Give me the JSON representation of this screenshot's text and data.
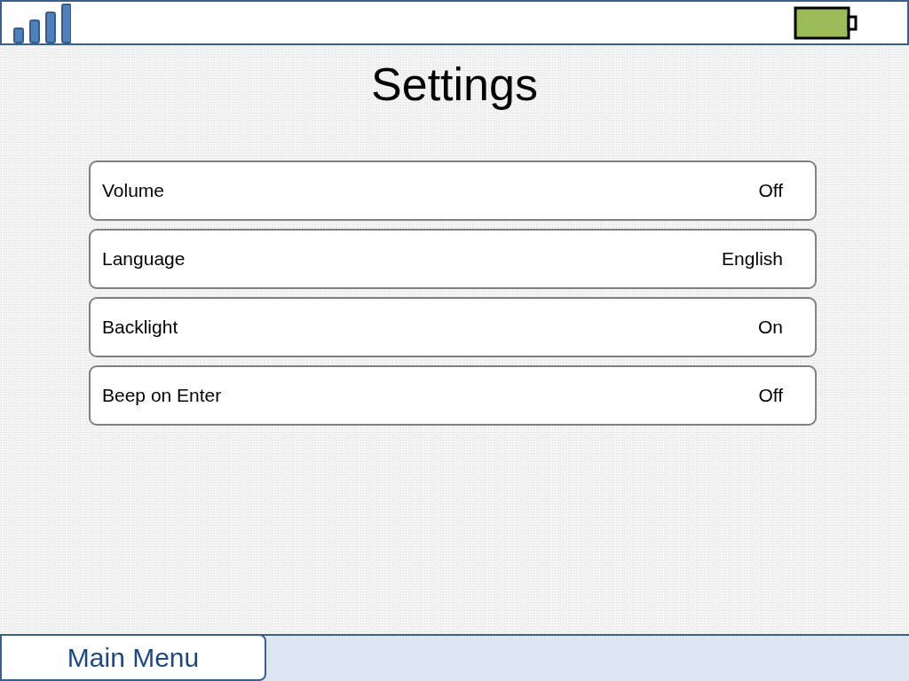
{
  "title": "Settings",
  "settings": [
    {
      "label": "Volume",
      "value": "Off"
    },
    {
      "label": "Language",
      "value": "English"
    },
    {
      "label": "Backlight",
      "value": "On"
    },
    {
      "label": "Beep on Enter",
      "value": "Off"
    }
  ],
  "bottom_bar": {
    "button": "Main Menu"
  }
}
